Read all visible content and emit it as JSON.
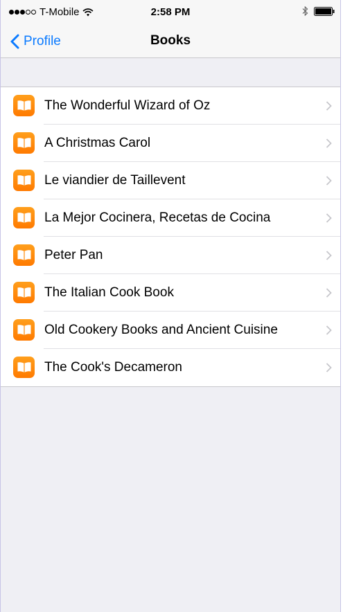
{
  "status_bar": {
    "carrier": "T-Mobile",
    "signal_bars_total": 5,
    "signal_bars_filled": 3,
    "time": "2:58 PM",
    "wifi_icon": "wifi-icon",
    "bluetooth_icon": "bluetooth-icon",
    "battery_icon": "battery-icon"
  },
  "nav": {
    "back_label": "Profile",
    "back_icon": "chevron-left-icon",
    "title": "Books"
  },
  "books": [
    {
      "title": "The Wonderful Wizard of Oz"
    },
    {
      "title": "A Christmas Carol"
    },
    {
      "title": "Le viandier de Taillevent"
    },
    {
      "title": "La Mejor Cocinera, Recetas de Cocina"
    },
    {
      "title": "Peter Pan"
    },
    {
      "title": "The Italian Cook Book"
    },
    {
      "title": "Old Cookery Books and Ancient Cuisine"
    },
    {
      "title": "The Cook's Decameron"
    }
  ],
  "colors": {
    "accent": "#0a7aff",
    "book_icon": "#ff8c0a",
    "background": "#efeff4"
  }
}
